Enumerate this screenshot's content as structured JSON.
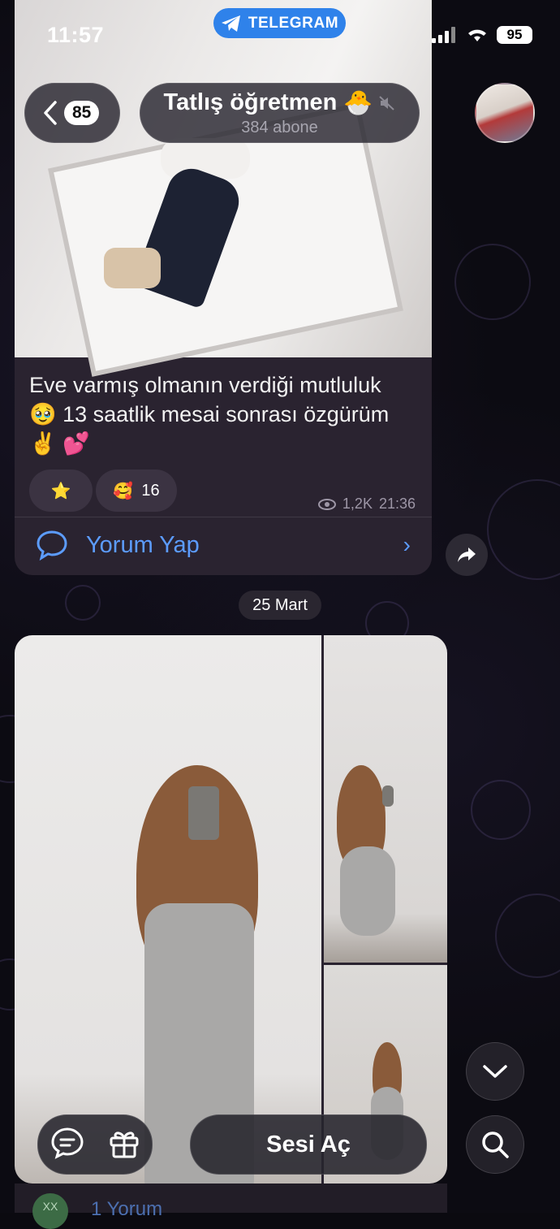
{
  "status_bar": {
    "time": "11:57",
    "app_pill": "TELEGRAM",
    "battery": "95"
  },
  "header": {
    "back_count": "85",
    "channel_name": "Tatlış öğretmen",
    "channel_emoji": "🐣",
    "subscribers": "384 abone",
    "muted": true
  },
  "message1": {
    "text_line1": "Eve varmış olmanın verdiği mutluluk",
    "text_line2": "🥹 13 saatlik mesai sonrası özgürüm",
    "text_line3": "✌️ 💕",
    "reactions": [
      {
        "emoji": "⭐",
        "count": ""
      },
      {
        "emoji": "🥰",
        "count": "16"
      }
    ],
    "views": "1,2K",
    "time": "21:36",
    "comment_label": "Yorum Yap"
  },
  "date_separator": "25 Mart",
  "message2": {
    "sound_button": "Sesi Aç",
    "next_preview_avatar": "XX",
    "next_preview_label": "1 Yorum"
  },
  "colors": {
    "accent_blue": "#2f82ea",
    "link_blue": "#5c9cff",
    "bubble": "#2a2330"
  }
}
